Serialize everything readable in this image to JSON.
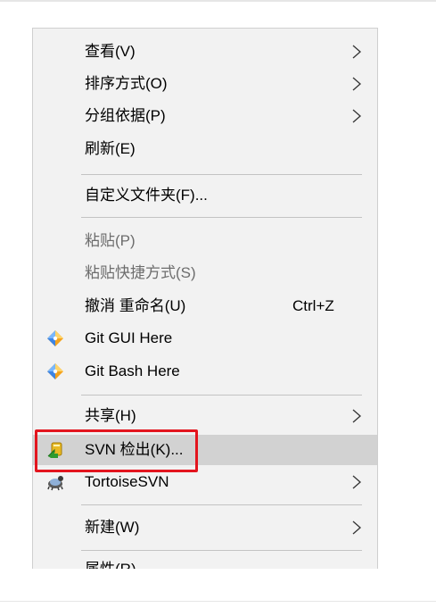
{
  "menu": {
    "view": "查看(V)",
    "sort_by": "排序方式(O)",
    "group_by": "分组依据(P)",
    "refresh": "刷新(E)",
    "customize_folder": "自定义文件夹(F)...",
    "paste": "粘贴(P)",
    "paste_shortcut": "粘贴快捷方式(S)",
    "undo_rename": "撤消 重命名(U)",
    "undo_rename_shortcut": "Ctrl+Z",
    "git_gui": "Git GUI Here",
    "git_bash": "Git Bash Here",
    "share": "共享(H)",
    "svn_checkout": "SVN 检出(K)...",
    "tortoisesvn": "TortoiseSVN",
    "new": "新建(W)",
    "properties": "属性(R)"
  },
  "icons": {
    "git": "git-diamond-icon",
    "svn_checkout": "svn-checkout-icon",
    "tortoisesvn": "tortoise-icon",
    "submenu": "chevron-right-icon"
  },
  "colors": {
    "menu_background": "#f2f2f2",
    "hover_background": "#d2d2d2",
    "disabled_text": "#6d6d6d",
    "highlight_border": "#e3151e"
  }
}
